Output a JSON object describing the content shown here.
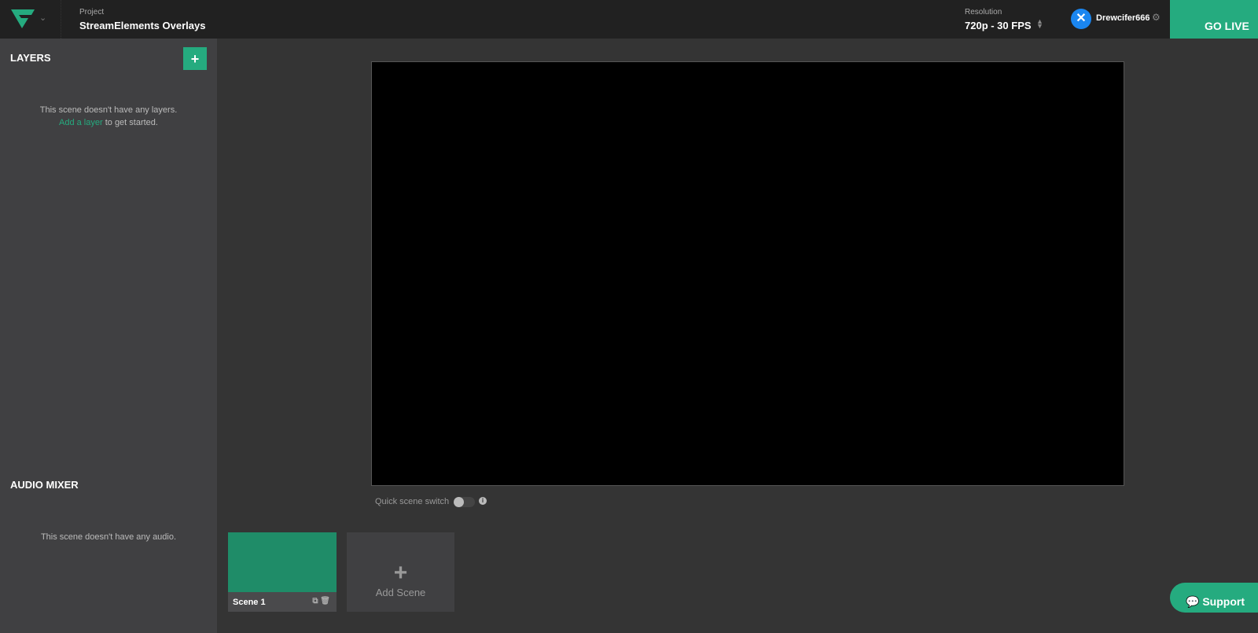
{
  "header": {
    "project_label": "Project",
    "project_name": "StreamElements Overlays",
    "resolution_label": "Resolution",
    "resolution_value": "720p - 30 FPS",
    "username": "Drewcifer666",
    "go_live": "GO LIVE",
    "accent": "#25ab7f"
  },
  "layers": {
    "title": "LAYERS",
    "add_icon": "+",
    "empty_text": "This scene doesn't have any layers.",
    "add_link": "Add a layer",
    "add_suffix": " to get started."
  },
  "audio": {
    "title": "AUDIO MIXER",
    "empty_text": "This scene doesn't have any audio."
  },
  "preview": {
    "quick_switch_label": "Quick scene switch",
    "quick_switch_on": false
  },
  "scenes": {
    "items": [
      {
        "name": "Scene 1"
      }
    ],
    "add_label": "Add Scene"
  },
  "support": {
    "label": "Support"
  }
}
